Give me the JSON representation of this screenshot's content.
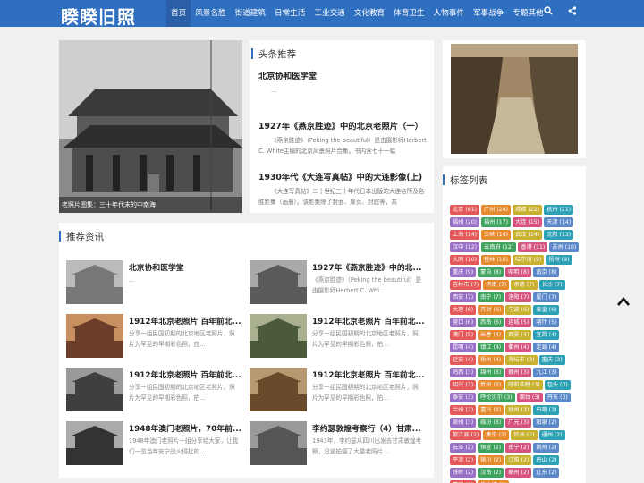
{
  "nav": {
    "logo": "睽睽旧照",
    "items": [
      "首页",
      "风景名胜",
      "街道建筑",
      "日常生活",
      "工业交通",
      "文化教育",
      "体育卫生",
      "人物事件",
      "军事战争",
      "专题其他"
    ],
    "search_icon": "search-icon",
    "share_icon": "share-icon"
  },
  "hero": {
    "caption": "老照片图集：三十年代末的中南海"
  },
  "headlines": {
    "title": "头条推荐",
    "items": [
      {
        "title": "北京协和医学堂",
        "desc": "..."
      },
      {
        "title": "1927年《燕京胜迹》中的北京老照片（一）",
        "desc": "《燕京胜迹》（Peking the beautiful）是由摄影师Herbert C. White主编的北京风景照片合集。书内含七十一幅"
      },
      {
        "title": "1930年代《大连写真帖》中的大连影像(上)",
        "desc": "《大连写真帖》二十世纪三十年代日本出版的大连名所及名胜影集（画册）。该影集除了封面、扉页、封底等，共"
      }
    ]
  },
  "recommend": {
    "title": "推荐资讯",
    "items": [
      {
        "title": "北京协和医学堂",
        "desc": "..."
      },
      {
        "title": "1927年《燕京胜迹》中的北...",
        "desc": "《燕京胜迹》（Peking the beautiful）是由摄影师Herbert C. Whi..."
      },
      {
        "title": "1912年北京老照片 百年前北...",
        "desc": "分享一组民国初期的北京地区老照片，照片为罕见的早期彩色照，应..."
      },
      {
        "title": "1912年北京老照片 百年前北...",
        "desc": "分享一组民国初期的北京地区老照片，照片为罕见的早期彩色照，拍..."
      },
      {
        "title": "1912年北京老照片 百年前北...",
        "desc": "分享一组民国初期的北京地区老照片，照片为罕见的早期彩色照，拍..."
      },
      {
        "title": "1912年北京老照片 百年前北...",
        "desc": "分享一组民国初期的北京地区老照片，照片为罕见的早期彩色照，拍..."
      },
      {
        "title": "1948年澳门老照片，70年前...",
        "desc": "1948年澳门老照片一组分享给大家，让我们一览当年安宁战火侵扰的..."
      },
      {
        "title": "李约瑟敦煌考察行（4）甘肃...",
        "desc": "1943年，李约瑟从四川出发去甘肃敦煌考察，沿途拍摄了大量老照片..."
      }
    ]
  },
  "tags": {
    "title": "标签列表",
    "colors": [
      "#e5585a",
      "#e68a2e",
      "#c8b12e",
      "#2ca0b5",
      "#9a6fc7",
      "#3da35d",
      "#d6537f",
      "#5a88c9"
    ],
    "items": [
      "北京 (61)",
      "广州 (24)",
      "成都 (22)",
      "杭州 (21)",
      "福州 (20)",
      "福州 (17)",
      "大连 (15)",
      "天津 (14)",
      "上海 (14)",
      "三峡 (14)",
      "武汉 (14)",
      "沈阳 (13)",
      "汉中 (12)",
      "云南府 (12)",
      "香港 (11)",
      "苏州 (10)",
      "大同 (10)",
      "桂林 (10)",
      "哈尔滨 (9)",
      "扬州 (9)",
      "重庆 (9)",
      "蒙自 (8)",
      "昭明 (8)",
      "南京 (8)",
      "吉林市 (7)",
      "济南 (7)",
      "承德 (7)",
      "长沙 (7)",
      "西安 (7)",
      "南宁 (7)",
      "洛阳 (7)",
      "厦门 (7)",
      "大理 (6)",
      "开封 (6)",
      "宁波 (6)",
      "秦皇 (6)",
      "营口 (6)",
      "西南 (6)",
      "运城 (5)",
      "喀什 (5)",
      "澳门 (5)",
      "长春 (4)",
      "西夏 (4)",
      "宜昌 (4)",
      "昆明 (4)",
      "镇江 (4)",
      "衢州 (4)",
      "定县 (4)",
      "延安 (4)",
      "梧州 (4)",
      "海坛市 (3)",
      "重庆 (3)",
      "鸡西 (3)",
      "锦州 (3)",
      "赣州 (3)",
      "九江 (3)",
      "绍兴 (3)",
      "忻州 (3)",
      "呼和浩特 (3)",
      "包头 (3)",
      "泰安 (3)",
      "呼伦贝尔 (3)",
      "烟台 (3)",
      "丹东 (3)",
      "兰州 (3)",
      "嘉兴 (3)",
      "徐州 (3)",
      "日喀 (3)",
      "泉州 (3)",
      "临汾 (3)",
      "广元 (3)",
      "阳泉 (2)",
      "歙江县 (2)",
      "集宁 (2)",
      "钦州 (2)",
      "通州 (2)",
      "云泽 (2)",
      "恒宜 (2)",
      "南宁 (2)",
      "荆州 (2)",
      "平凉 (2)",
      "铜川 (2)",
      "辽阳 (2)",
      "丹山 (2)",
      "铁岭 (2)",
      "汉南 (2)",
      "蕲州 (2)",
      "辽东 (2)",
      "嘉定 (2)",
      "乐山城 (2)"
    ]
  }
}
